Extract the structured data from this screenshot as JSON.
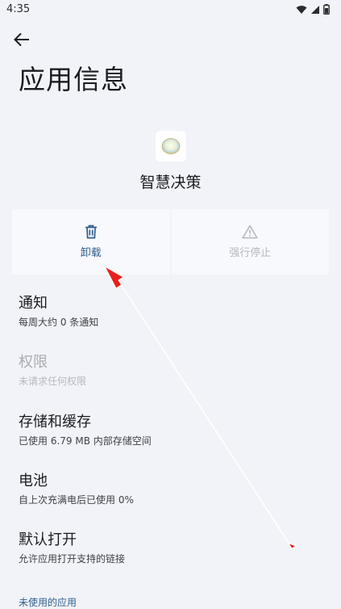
{
  "status_bar": {
    "time": "4:35",
    "icons": [
      "wifi-icon",
      "signal-icon",
      "battery-icon"
    ]
  },
  "header": {
    "back_icon": "arrow-left-icon",
    "title": "应用信息"
  },
  "app": {
    "name": "智慧决策",
    "icon": "app-icon"
  },
  "actions": {
    "uninstall_label": "卸载",
    "uninstall_icon": "trash-icon",
    "force_stop_label": "强行停止",
    "force_stop_icon": "warning-icon"
  },
  "settings": [
    {
      "title": "通知",
      "subtitle": "每周大约 0 条通知",
      "enabled": true
    },
    {
      "title": "权限",
      "subtitle": "未请求任何权限",
      "enabled": false
    },
    {
      "title": "存储和缓存",
      "subtitle": "已使用 6.79 MB 内部存储空间",
      "enabled": true
    },
    {
      "title": "电池",
      "subtitle": "自上次充满电后已使用 0%",
      "enabled": true
    },
    {
      "title": "默认打开",
      "subtitle": "允许应用打开支持的链接",
      "enabled": true
    }
  ],
  "section_header": "未使用的应用",
  "colors": {
    "background": "#f1f3f8",
    "accent": "#2f5f90",
    "annotation_arrow": "#e8201f"
  }
}
